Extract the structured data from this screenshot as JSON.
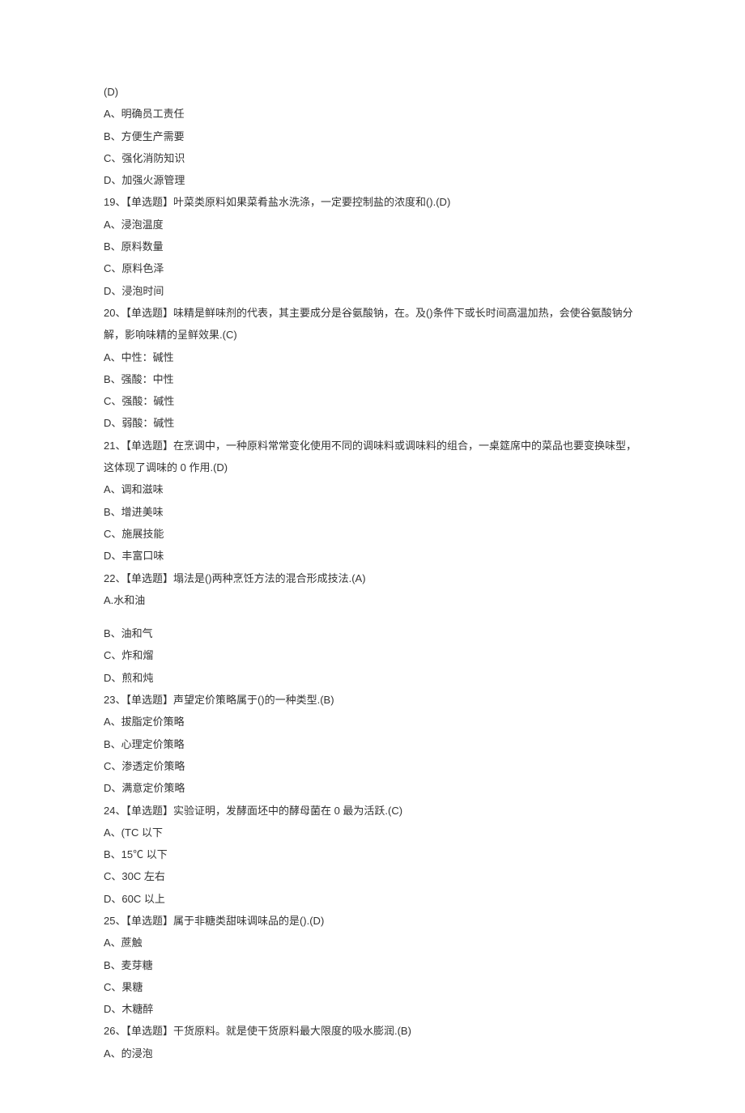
{
  "intro": {
    "line1": "(D)",
    "optA": "A、明确员工责任",
    "optB": "B、方便生产需要",
    "optC": "C、强化消防知识",
    "optD": "D、加强火源管理"
  },
  "q19": {
    "stem": "19、【单选题】叶菜类原料如果菜肴盐水洗涤，一定要控制盐的浓度和().(D)",
    "optA": "A、浸泡温度",
    "optB": "B、原料数量",
    "optC": "C、原料色泽",
    "optD": "D、浸泡时间"
  },
  "q20": {
    "stem": "20、【单选题】味精是鲜味剂的代表，其主要成分是谷氨酸钠，在。及()条件下或长时间高温加热，会使谷氨酸钠分解，影响味精的呈鲜效果.(C)",
    "optA": "A、中性：碱性",
    "optB": "B、强酸：中性",
    "optC": "C、强酸：碱性",
    "optD": "D、弱酸：碱性"
  },
  "q21": {
    "stem": "21、【单选题】在烹调中，一种原料常常变化使用不同的调味料或调味料的组合，一桌筵席中的菜品也要变换味型，这体现了调味的 0 作用.(D)",
    "optA": "A、调和滋味",
    "optB": "B、增进美味",
    "optC": "C、施展技能",
    "optD": "D、丰富口味"
  },
  "q22": {
    "stem": "22、【单选题】塌法是()两种烹饪方法的混合形成技法.(A)",
    "optA": "A.水和油",
    "optB": "B、油和气",
    "optC": "C、炸和熘",
    "optD": "D、煎和炖"
  },
  "q23": {
    "stem": "23、【单选题】声望定价策略属于()的一种类型.(B)",
    "optA": "A、拔脂定价策略",
    "optB": "B、心理定价策略",
    "optC": "C、渗透定价策略",
    "optD": "D、满意定价策略"
  },
  "q24": {
    "stem": "24、【单选题】实验证明，发酵面坯中的酵母菌在 0 最为活跃.(C)",
    "optA": "A、(TC 以下",
    "optB": "B、15℃ 以下",
    "optC": "C、30C 左右",
    "optD": "D、60C 以上"
  },
  "q25": {
    "stem": "25、【单选题】属于非糖类甜味调味品的是().(D)",
    "optA": "A、蔗触",
    "optB": "B、麦芽糖",
    "optC": "C、果糖",
    "optD": "D、木糖醉"
  },
  "q26": {
    "stem": "26、【单选题】干货原料。就是使干货原料最大限度的吸水膨润.(B)",
    "optA": "A、的浸泡"
  }
}
